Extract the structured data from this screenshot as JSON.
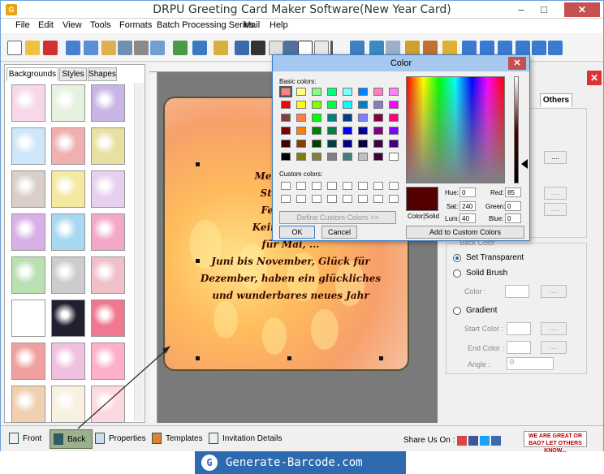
{
  "window": {
    "title": "DRPU Greeting Card Maker Software(New Year Card)",
    "minimize": "–",
    "maximize": "□",
    "close": "✕"
  },
  "menu": [
    "File",
    "Edit",
    "View",
    "Tools",
    "Formats",
    "Batch Processing Series",
    "Mail",
    "Help"
  ],
  "left_panel": {
    "tabs": [
      "Backgrounds",
      "Styles",
      "Shapes"
    ],
    "active_tab": "Backgrounds"
  },
  "card": {
    "lines": [
      "Meine Wün...",
      "Start für ...",
      "Februar, ...",
      "Keine Sorge...",
      "für Mai, ...",
      "Juni bis November, Glück für",
      "Dezember, haben ein glückliches",
      "und wunderbares neues Jahr"
    ],
    "text_color": "#3a0a00"
  },
  "right_panel": {
    "tab_others": "Others",
    "bg_color_group": "Back Color",
    "set_transparent": "Set Transparent",
    "solid_brush": "Solid Brush",
    "color_label": "Color :",
    "gradient": "Gradient",
    "start_color": "Start Color :",
    "end_color": "End Color :",
    "angle": "Angle :",
    "angle_value": "0",
    "dots": "...."
  },
  "color_dialog": {
    "title": "Color",
    "basic_colors_label": "Basic colors:",
    "custom_colors_label": "Custom colors:",
    "define_custom": "Define Custom Colors >>",
    "ok": "OK",
    "cancel": "Cancel",
    "add_custom": "Add to Custom Colors",
    "color_solid": "Color|Solid",
    "hue_label": "Hue:",
    "hue": "0",
    "sat_label": "Sat:",
    "sat": "240",
    "lum_label": "Lum:",
    "lum": "40",
    "red_label": "Red:",
    "red": "85",
    "green_label": "Green:",
    "green": "0",
    "blue_label": "Blue:",
    "blue": "0",
    "selected_color": "#550000",
    "basic_colors": [
      "#ff8080",
      "#ffff80",
      "#80ff80",
      "#00ff80",
      "#80ffff",
      "#0080ff",
      "#ff80c0",
      "#ff80ff",
      "#ff0000",
      "#ffff00",
      "#80ff00",
      "#00ff40",
      "#00ffff",
      "#0080c0",
      "#8080c0",
      "#ff00ff",
      "#804040",
      "#ff8040",
      "#00ff00",
      "#008080",
      "#004080",
      "#8080ff",
      "#800040",
      "#ff0080",
      "#800000",
      "#ff8000",
      "#008000",
      "#008040",
      "#0000ff",
      "#0000a0",
      "#800080",
      "#8000ff",
      "#400000",
      "#804000",
      "#004000",
      "#004040",
      "#000080",
      "#000040",
      "#400040",
      "#400080",
      "#000000",
      "#808000",
      "#808040",
      "#808080",
      "#408080",
      "#c0c0c0",
      "#400040",
      "#ffffff"
    ]
  },
  "bottom_bar": {
    "front": "Front",
    "back": "Back",
    "properties": "Properties",
    "templates": "Templates",
    "invitation": "Invitation Details",
    "share": "Share Us On :",
    "feedback": "WE ARE GREAT OR BAD? LET OTHERS KNOW..."
  },
  "watermark": {
    "icon": "G",
    "text": "Generate-Barcode.com"
  },
  "thumb_colors": [
    [
      "#f7d7e8",
      "#e6f2e0",
      "#c9b4e6"
    ],
    [
      "#cde6fa",
      "#f0b0b0",
      "#e8e0a0"
    ],
    [
      "#d9cfc8",
      "#f4e9a0",
      "#e6d0f0"
    ],
    [
      "#d8b0e8",
      "#a8d8f0",
      "#f4a8c8"
    ],
    [
      "#b8e0b0",
      "#cccccc",
      "#f0c0c8"
    ],
    [
      "#ffffff",
      "#202030",
      "#f07890"
    ],
    [
      "#f0a0a0",
      "#f0c0e0",
      "#ffb0c8"
    ],
    [
      "#f0d0b0",
      "#f8f0e0",
      "#fcd8e0"
    ]
  ]
}
